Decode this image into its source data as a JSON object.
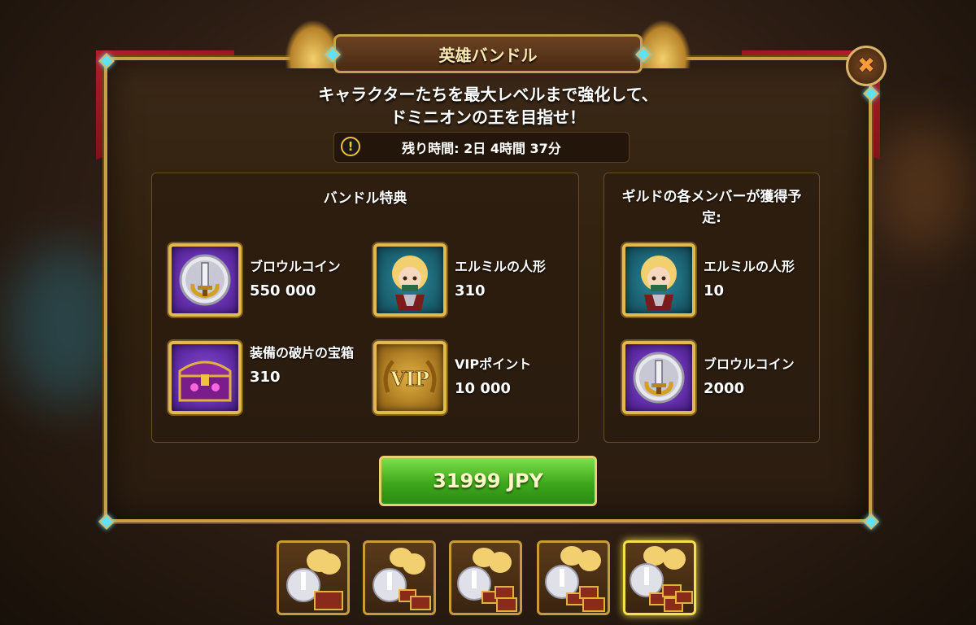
{
  "dialog": {
    "title": "英雄バンドル",
    "subtitle_line1": "キャラクターたちを最大レベルまで強化して、",
    "subtitle_line2": "ドミニオンの王を目指せ！",
    "timer_icon": "exclamation-icon",
    "timer_text": "残り時間: 2日 4時間 37分",
    "close_icon": "close-x-icon",
    "close_glyph": "✖"
  },
  "bundle_rewards": {
    "title": "バンドル特典",
    "items": [
      {
        "name": "ブロウルコイン",
        "qty": "550 000",
        "icon": "brawl-coin-icon"
      },
      {
        "name": "エルミルの人形",
        "qty": "310",
        "icon": "elmir-doll-icon"
      },
      {
        "name": "装備の破片の宝箱",
        "qty": "310",
        "icon": "equipment-shard-chest-icon"
      },
      {
        "name": "VIPポイント",
        "qty": "10 000",
        "icon": "vip-points-icon"
      }
    ]
  },
  "guild_rewards": {
    "title": "ギルドの各メンバーが獲得予定:",
    "items": [
      {
        "name": "エルミルの人形",
        "qty": "10",
        "icon": "elmir-doll-icon"
      },
      {
        "name": "ブロウルコイン",
        "qty": "2000",
        "icon": "brawl-coin-icon"
      }
    ]
  },
  "purchase": {
    "price_label": "31999 JPY"
  },
  "bundle_tabs": {
    "count": 5,
    "selected_index": 4
  },
  "vip_label": "VIP",
  "colors": {
    "frame_gold": "#c9a04a",
    "buy_green": "#3ea81c",
    "gem_cyan": "#5ee3ff",
    "curtain_red": "#c2202a"
  }
}
